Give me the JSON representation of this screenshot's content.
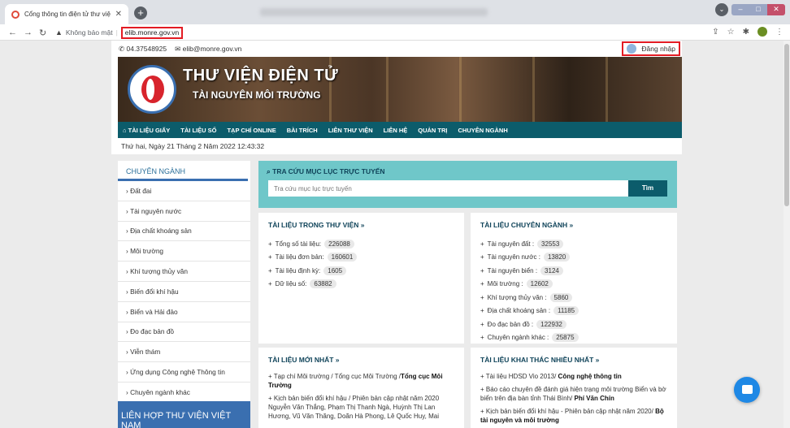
{
  "browser": {
    "tab_title": "Cổng thông tin điện tử thư viện",
    "not_secure": "Không bảo mật",
    "url": "elib.monre.gov.vn"
  },
  "topbar": {
    "phone": "04.37548925",
    "email": "elib@monre.gov.vn",
    "login": "Đăng nhập"
  },
  "banner": {
    "title": "THƯ VIỆN ĐIỆN TỬ",
    "subtitle": "TÀI NGUYÊN MÔI TRƯỜNG"
  },
  "nav": [
    "TÀI LIỆU GIẤY",
    "TÀI LIỆU SỐ",
    "TẠP CHÍ ONLINE",
    "BÀI TRÍCH",
    "LIÊN THƯ VIỆN",
    "LIÊN HỆ",
    "QUẢN TRỊ",
    "CHUYÊN NGÀNH"
  ],
  "date": "Thứ hai, Ngày 21 Tháng 2 Năm 2022 12:43:32",
  "sidebar": {
    "heading": "CHUYÊN NGÀNH",
    "items": [
      "Đất đai",
      "Tài nguyên nước",
      "Địa chất khoáng sản",
      "Môi trường",
      "Khí tượng thủy văn",
      "Biến đổi khí hậu",
      "Biển và Hải đảo",
      "Đo đạc bản đồ",
      "Viễn thám",
      "Ứng dụng Công nghệ Thông tin",
      "Chuyên ngành khác"
    ],
    "banner": "LIÊN HỢP THƯ VIỆN VIỆT NAM"
  },
  "search": {
    "title": "TRA CỨU MỤC LỤC TRỰC TUYẾN",
    "placeholder": "Tra cứu mục lục trực tuyến",
    "button": "Tìm"
  },
  "library_docs": {
    "title": "TÀI LIỆU TRONG THƯ VIỆN »",
    "items": [
      {
        "label": "Tổng số tài liệu:",
        "value": "226088"
      },
      {
        "label": "Tài liệu đơn bản:",
        "value": "160601"
      },
      {
        "label": "Tài liệu định kỳ:",
        "value": "1605"
      },
      {
        "label": "Dữ liệu số:",
        "value": "63882"
      }
    ]
  },
  "specialized_docs": {
    "title": "TÀI LIỆU CHUYÊN NGÀNH »",
    "items": [
      {
        "label": "Tài nguyên đất :",
        "value": "32553"
      },
      {
        "label": "Tài nguyên nước :",
        "value": "13820"
      },
      {
        "label": "Tài nguyên biển :",
        "value": "3124"
      },
      {
        "label": "Môi trường :",
        "value": "12602"
      },
      {
        "label": "Khí tượng thủy văn :",
        "value": "5860"
      },
      {
        "label": "Địa chất khoáng sản :",
        "value": "11185"
      },
      {
        "label": "Đo đạc bản đồ :",
        "value": "122932"
      },
      {
        "label": "Chuyên ngành khác :",
        "value": "25875"
      }
    ]
  },
  "newest_docs": {
    "title": "TÀI LIỆU MỚI NHẤT »",
    "item1_text": "Tạp chí Môi trường / Tổng cục Môi Trường /",
    "item1_bold": "Tổng cục Môi Trường",
    "item2_text": "Kịch bản biến đổi khí hậu / Phiên bản cập nhật năm 2020 Nguyễn Văn Thắng, Phạm Thị Thanh Ngà, Huỳnh Thị Lan Hương, Vũ Văn Thăng, Doãn Hà Phong, Lê Quốc Huy, Mai"
  },
  "most_used": {
    "title": "TÀI LIỆU KHAI THÁC NHIỀU NHẤT »",
    "item1_text": "Tài liệu HDSD Vio 2013/",
    "item1_bold": "Công nghệ thông tin",
    "item2_text": "Báo cáo chuyên đề đánh giá hiện trạng môi trường Biển và bờ biển trên địa bàn tỉnh Thái Bình/",
    "item2_bold": "Phí Văn Chín",
    "item3_text": "Kịch bản biến đổi khí hậu - Phiên bản cập nhật năm 2020/",
    "item3_bold": "Bộ tài nguyên và môi trường"
  }
}
